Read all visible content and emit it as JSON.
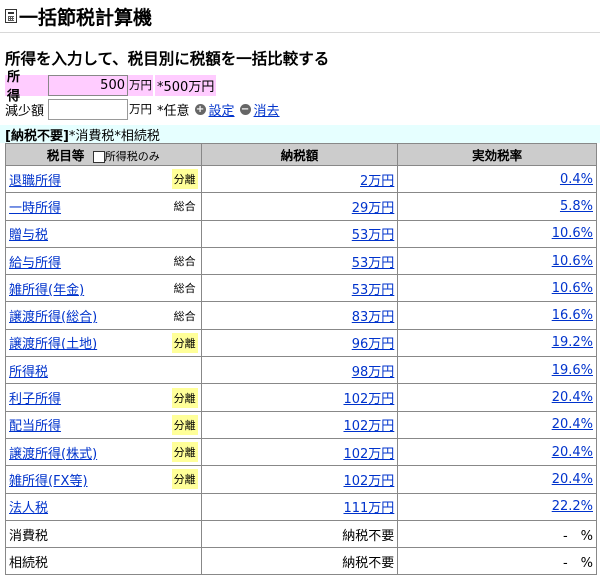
{
  "app": {
    "title": "一括節税計算機"
  },
  "subtitle": "所得を入力して、税目別に税額を一括比較する",
  "income": {
    "label": "所　得",
    "value": "500",
    "unit": "万円",
    "hint": "*500万円"
  },
  "deduction": {
    "label": "減少額",
    "value": "",
    "unit": "万円",
    "note": "*任意",
    "set_label": "設定",
    "clear_label": "消去"
  },
  "tax_free": {
    "bold": "[納税不要]",
    "text": "*消費税*相続税"
  },
  "table": {
    "headers": {
      "tax_type": "税目等",
      "income_only": "所得税のみ",
      "amount": "納税額",
      "rate": "実効税率"
    },
    "rows": [
      {
        "name": "退職所得",
        "tag": "分離",
        "tag_type": "bunri",
        "amount": "2万円",
        "rate": "0.4%",
        "link": true
      },
      {
        "name": "一時所得",
        "tag": "総合",
        "tag_type": "sogo",
        "amount": "29万円",
        "rate": "5.8%",
        "link": true
      },
      {
        "name": "贈与税",
        "tag": "",
        "tag_type": "",
        "amount": "53万円",
        "rate": "10.6%",
        "link": true
      },
      {
        "name": "給与所得",
        "tag": "総合",
        "tag_type": "sogo",
        "amount": "53万円",
        "rate": "10.6%",
        "link": true
      },
      {
        "name": "雑所得(年金)",
        "tag": "総合",
        "tag_type": "sogo",
        "amount": "53万円",
        "rate": "10.6%",
        "link": true
      },
      {
        "name": "譲渡所得(総合)",
        "tag": "総合",
        "tag_type": "sogo",
        "amount": "83万円",
        "rate": "16.6%",
        "link": true
      },
      {
        "name": "譲渡所得(土地)",
        "tag": "分離",
        "tag_type": "bunri",
        "amount": "96万円",
        "rate": "19.2%",
        "link": true
      },
      {
        "name": "所得税",
        "tag": "",
        "tag_type": "",
        "amount": "98万円",
        "rate": "19.6%",
        "link": true
      },
      {
        "name": "利子所得",
        "tag": "分離",
        "tag_type": "bunri",
        "amount": "102万円",
        "rate": "20.4%",
        "link": true
      },
      {
        "name": "配当所得",
        "tag": "分離",
        "tag_type": "bunri",
        "amount": "102万円",
        "rate": "20.4%",
        "link": true
      },
      {
        "name": "譲渡所得(株式)",
        "tag": "分離",
        "tag_type": "bunri",
        "amount": "102万円",
        "rate": "20.4%",
        "link": true
      },
      {
        "name": "雑所得(FX等)",
        "tag": "分離",
        "tag_type": "bunri",
        "amount": "102万円",
        "rate": "20.4%",
        "link": true
      },
      {
        "name": "法人税",
        "tag": "",
        "tag_type": "",
        "amount": "111万円",
        "rate": "22.2%",
        "link": true
      },
      {
        "name": "消費税",
        "tag": "",
        "tag_type": "",
        "amount": "納税不要",
        "rate": "-　%",
        "link": false
      },
      {
        "name": "相続税",
        "tag": "",
        "tag_type": "",
        "amount": "納税不要",
        "rate": "-　%",
        "link": false
      }
    ]
  },
  "colors": {
    "income_bg": "#ffccff",
    "tax_free_bg": "#e6ffff",
    "bunri_bg": "#ffff99",
    "header_bg": "#cccccc",
    "link": "#0033cc"
  },
  "icons": {
    "title": "calculator-icon",
    "set": "plus-circle-icon",
    "clear": "minus-circle-icon"
  }
}
